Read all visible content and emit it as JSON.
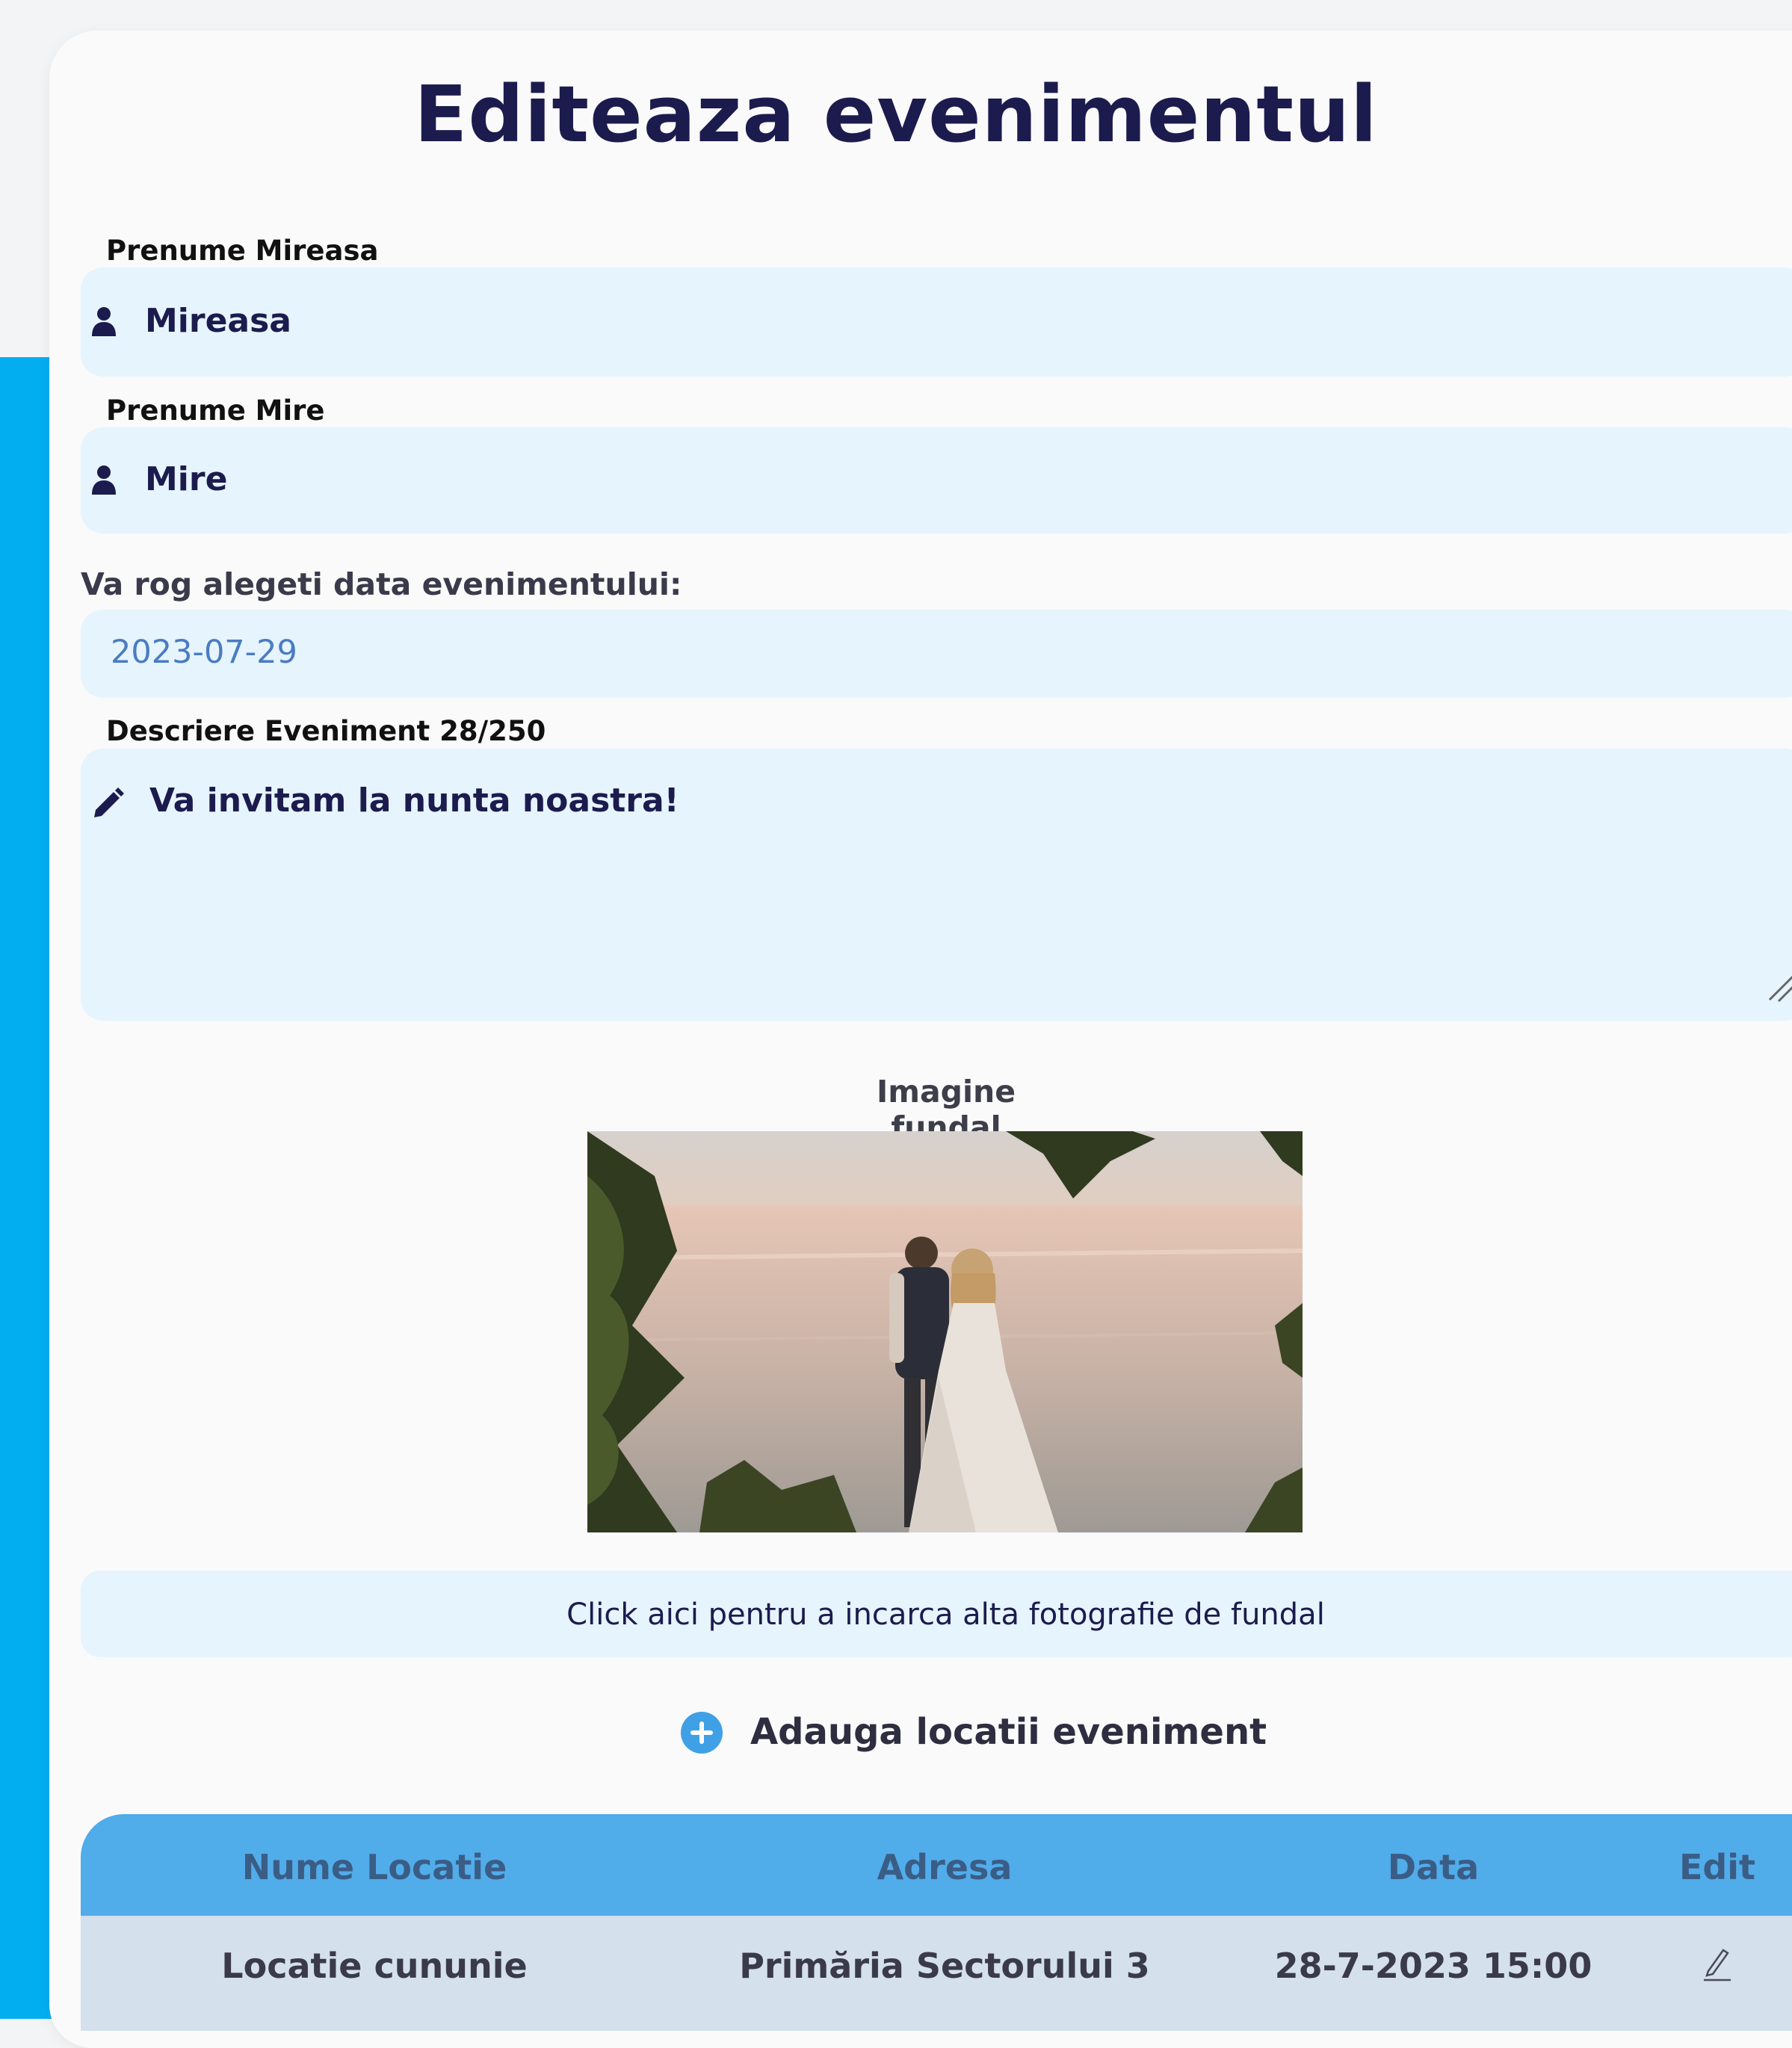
{
  "title": "Editeaza evenimentul",
  "bride": {
    "label": "Prenume Mireasa",
    "value": "Mireasa",
    "icon": "user-icon"
  },
  "groom": {
    "label": "Prenume Mire",
    "value": "Mire",
    "icon": "user-icon"
  },
  "date": {
    "label": "Va rog alegeti data evenimentului:",
    "value": "2023-07-29"
  },
  "description": {
    "label": "Descriere Eveniment 28/250",
    "value": "Va invitam la nunta noastra!",
    "icon": "pencil-icon"
  },
  "background": {
    "label": "Imagine fundal",
    "upload_label": "Click aici pentru a incarca alta fotografie de fundal"
  },
  "add_locations": {
    "label": "Adauga locatii eveniment",
    "icon": "plus-circle-icon"
  },
  "locations_table": {
    "columns": [
      "Nume Locatie",
      "Adresa",
      "Data",
      "Edit"
    ],
    "rows": [
      {
        "name": "Locatie cununie",
        "address": "Primăria Sectorului 3",
        "date": "28-7-2023 15:00",
        "edit_icon": "edit-pen-icon"
      }
    ]
  },
  "colors": {
    "accent": "#03aef0",
    "title": "#1c1b4e",
    "field_bg": "#e6f4fd",
    "table_header": "#51acea",
    "table_row": "#d4e0ec"
  }
}
